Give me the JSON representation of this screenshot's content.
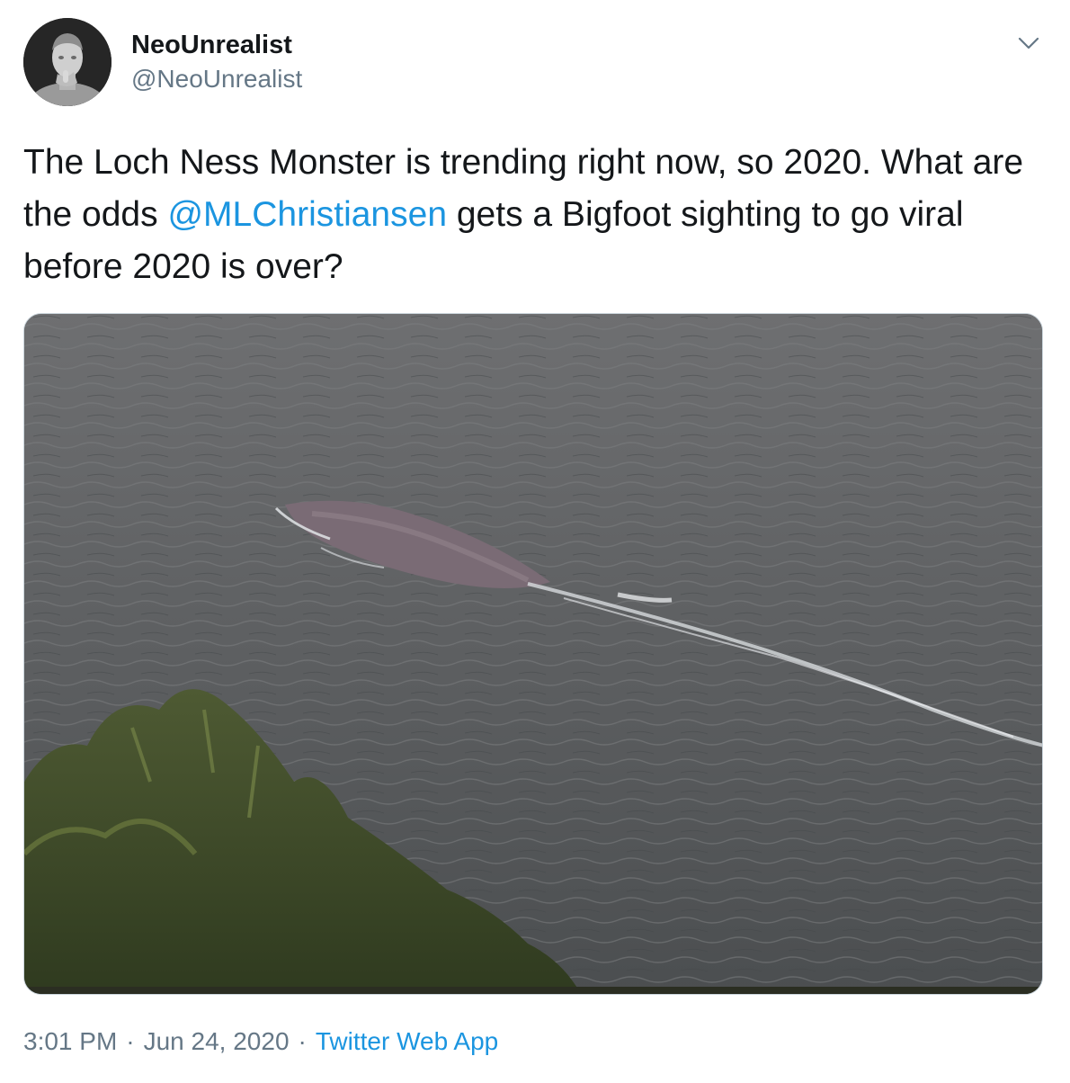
{
  "tweet": {
    "display_name": "NeoUnrealist",
    "handle": "@NeoUnrealist",
    "text_part1": "The Loch Ness Monster is trending right now, so 2020. What are the odds ",
    "mention": "@MLChristiansen",
    "text_part2": " gets a Bigfoot sighting to go viral before 2020 is over?",
    "time": "3:01 PM",
    "separator": "·",
    "date": "Jun 24, 2020",
    "source": "Twitter Web App"
  },
  "icons": {
    "menu": "chevron-down-icon",
    "avatar": "bust-statue-avatar"
  },
  "colors": {
    "text": "#14171a",
    "secondary": "#657786",
    "link": "#1b95e0",
    "border": "#ccd6dd"
  }
}
